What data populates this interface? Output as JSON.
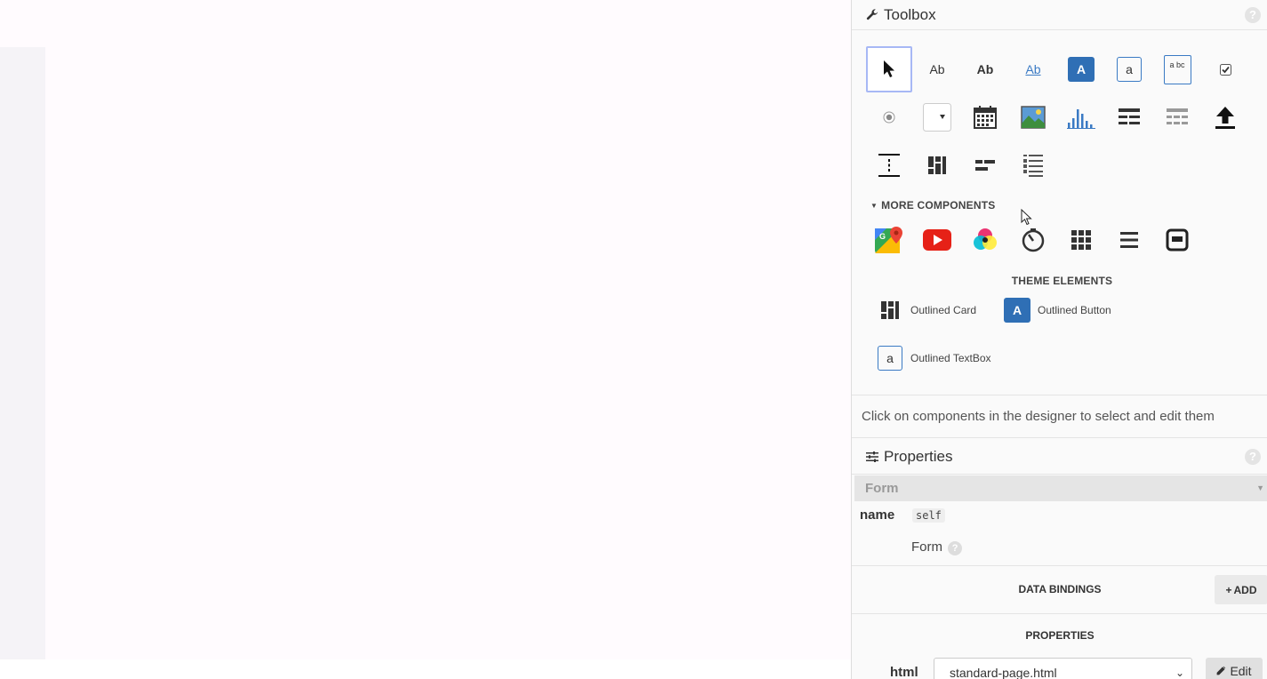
{
  "toolbox": {
    "title": "Toolbox",
    "help": "?",
    "basic_tools": [
      {
        "name": "pointer-tool-icon"
      },
      {
        "name": "label-tool-icon",
        "text": "Ab"
      },
      {
        "name": "bold-label-tool-icon",
        "text": "Ab"
      },
      {
        "name": "link-tool-icon",
        "text": "Ab"
      },
      {
        "name": "button-tool-icon",
        "text": "A"
      },
      {
        "name": "textbox-tool-icon",
        "text": "a"
      },
      {
        "name": "textarea-tool-icon",
        "text": "a bc"
      },
      {
        "name": "checkbox-tool-icon"
      },
      {
        "name": "radio-tool-icon"
      },
      {
        "name": "dropdown-tool-icon"
      },
      {
        "name": "datepicker-tool-icon"
      },
      {
        "name": "image-tool-icon"
      },
      {
        "name": "plot-tool-icon"
      },
      {
        "name": "data-grid-tool-icon"
      },
      {
        "name": "data-grid-2-tool-icon"
      },
      {
        "name": "file-loader-tool-icon"
      },
      {
        "name": "spacer-tool-icon"
      },
      {
        "name": "card-tool-icon"
      },
      {
        "name": "flow-panel-tool-icon"
      },
      {
        "name": "repeating-panel-tool-icon"
      }
    ],
    "more_components_label": "MORE COMPONENTS",
    "more_components": [
      {
        "name": "google-map-icon"
      },
      {
        "name": "youtube-icon"
      },
      {
        "name": "color-picker-icon"
      },
      {
        "name": "timer-icon"
      },
      {
        "name": "grid-panel-icon"
      },
      {
        "name": "column-panel-icon"
      },
      {
        "name": "linear-panel-icon"
      }
    ],
    "theme_elements_label": "THEME ELEMENTS",
    "theme_elements": [
      {
        "label": "Outlined Card",
        "icon": "outlined-card-icon"
      },
      {
        "label": "Outlined Button",
        "icon": "outlined-button-icon",
        "glyph": "A"
      },
      {
        "label": "Outlined TextBox",
        "icon": "outlined-textbox-icon",
        "glyph": "a"
      }
    ],
    "hint": "Click on components in the designer to select and edit them"
  },
  "properties": {
    "title": "Properties",
    "help": "?",
    "selected": "Form",
    "name_label": "name",
    "name_value": "self",
    "type_label": "Form",
    "data_bindings_label": "DATA BINDINGS",
    "add_label": "ADD",
    "properties_label": "PROPERTIES",
    "html_label": "html",
    "html_value": "standard-page.html",
    "edit_label": "Edit"
  },
  "colors": {
    "accent": "#3a7ac4",
    "selected_border": "#a7b8f5",
    "canvas_bg": "#fffbfe"
  }
}
